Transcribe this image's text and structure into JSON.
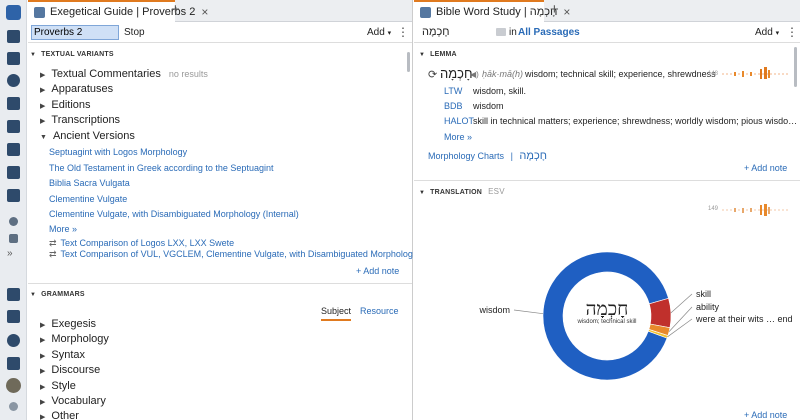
{
  "left_pane": {
    "tab_title": "Exegetical Guide | Proverbs 2",
    "tab_close": "×",
    "new_tab": "+",
    "reference_value": "Proverbs 2",
    "stop_label": "Stop",
    "add_label": "Add",
    "add_caret": "▾",
    "more_menu": "⋮",
    "textual_variants": {
      "header": "TEXTUAL VARIANTS",
      "items": [
        {
          "label": "Textual Commentaries",
          "note": "no results"
        },
        {
          "label": "Apparatuses"
        },
        {
          "label": "Editions"
        },
        {
          "label": "Transcriptions"
        },
        {
          "label": "Ancient Versions"
        }
      ],
      "versions": [
        "Septuagint with Logos Morphology",
        "The Old Testament in Greek according to the Septuagint",
        "Biblia Sacra Vulgata",
        "Clementine Vulgate",
        "Clementine Vulgate, with Disambiguated Morphology (Internal)"
      ],
      "more": "More »",
      "comparisons": [
        "Text Comparison of Logos LXX, LXX Swete",
        "Text Comparison of VUL, VGCLEM, Clementine Vulgate, with Disambiguated Morpholog…"
      ],
      "add_note": "+ Add note"
    },
    "grammars": {
      "header": "GRAMMARS",
      "subject_tab": "Subject",
      "resource_tab": "Resource",
      "items": [
        "Exegesis",
        "Morphology",
        "Syntax",
        "Discourse",
        "Style",
        "Vocabulary",
        "Other"
      ]
    }
  },
  "right_pane": {
    "tab_title": "Bible Word Study | חָכְמָה",
    "tab_close": "×",
    "new_tab": "+",
    "search_value": "חָכְמָה",
    "in_label": "in",
    "scope_label": "All Passages",
    "add_label": "Add",
    "add_caret": "▾",
    "more_menu": "⋮",
    "lemma": {
      "header": "LEMMA",
      "hebrew": "חָכְמָה",
      "translit": "ḥāk·mā(h)",
      "gloss": "wisdom; technical skill; experience, shrewdness",
      "count": "148",
      "sources": [
        {
          "abbr": "LTW",
          "text": "wisdom, skill."
        },
        {
          "abbr": "BDB",
          "text": "wisdom"
        },
        {
          "abbr": "HALOT",
          "text": "skill in technical matters; experience; shrewdness; worldly wisdom; pious wisdo…"
        }
      ],
      "more": "More »",
      "morphology_link": "Morphology Charts",
      "morphology_sep": "|",
      "morphology_word": "חָכְמָה",
      "add_note": "+ Add note"
    },
    "translation": {
      "header": "TRANSLATION",
      "version": "ESV",
      "count": "149",
      "center_word": "חָכְמָה",
      "center_gloss": "wisdom; technical skill",
      "add_note": "+ Add note"
    }
  },
  "chart_data": {
    "type": "pie",
    "title": "",
    "categories": [
      "wisdom",
      "skill",
      "ability",
      "were at their wits … end"
    ],
    "values": [
      134,
      11,
      3,
      1
    ],
    "colors": [
      "#1f5fc2",
      "#c0302c",
      "#e8892b",
      "#f2c230"
    ]
  }
}
